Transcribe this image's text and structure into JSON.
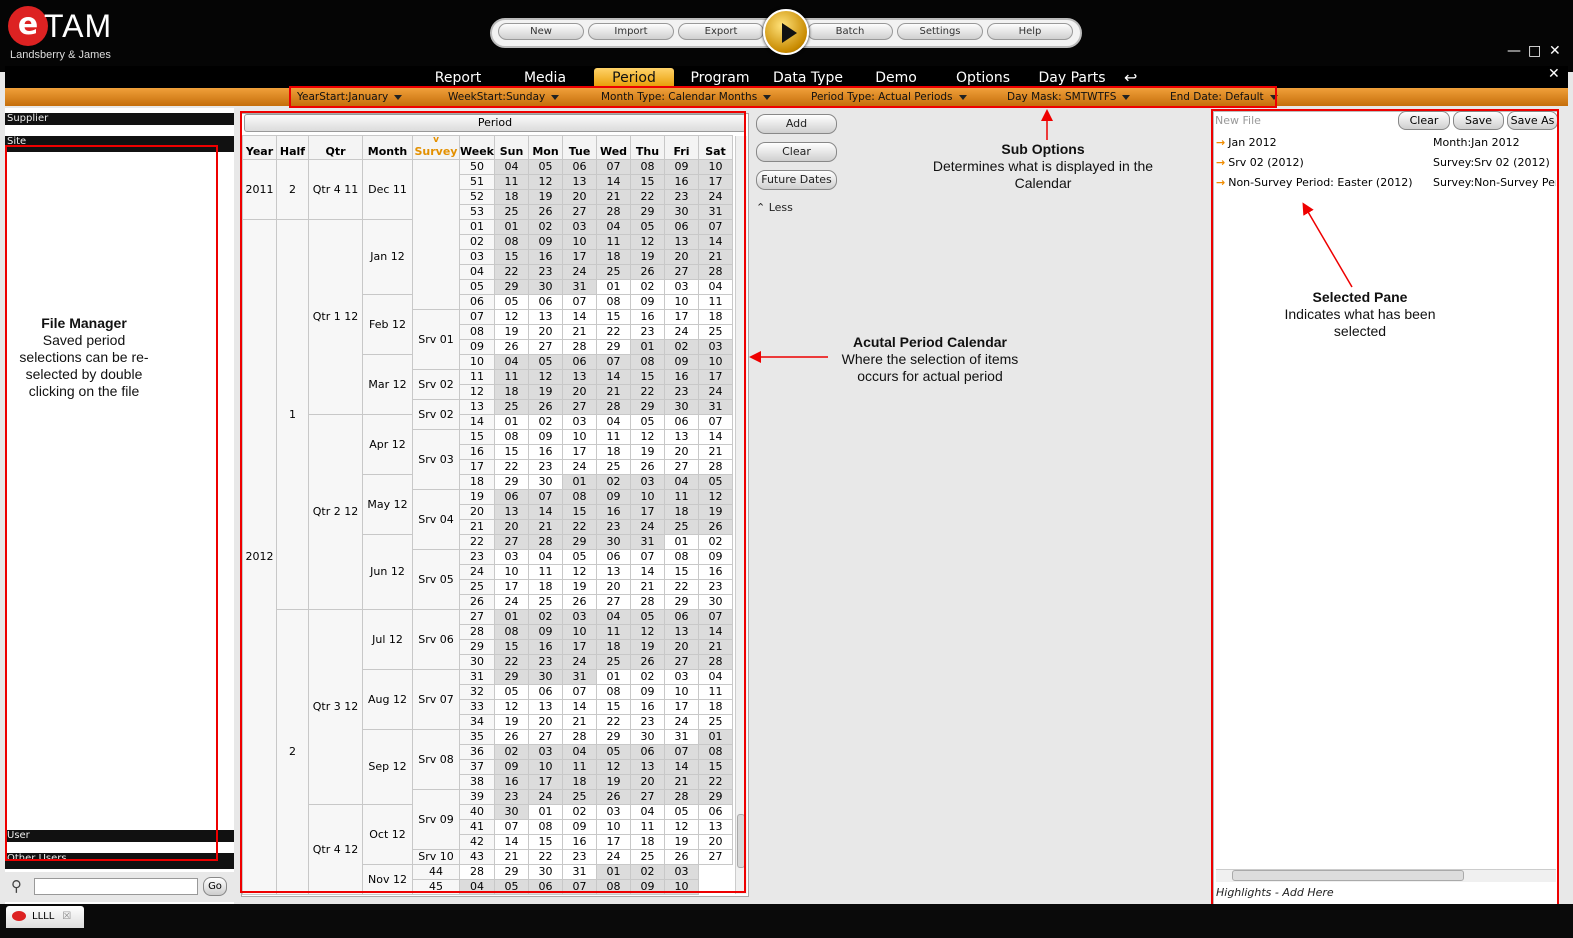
{
  "app": {
    "logo_letter": "e",
    "logo_name": "TAM",
    "logo_sub": "Landsberry & James"
  },
  "toolbar": {
    "buttons": [
      "New",
      "Import",
      "Export",
      "Batch",
      "Settings",
      "Help"
    ]
  },
  "nav": {
    "tabs": [
      "Report",
      "Media",
      "Period",
      "Program",
      "Data Type",
      "Demo",
      "Options",
      "Day Parts"
    ],
    "active": "Period"
  },
  "sub_options": [
    "YearStart:January",
    "WeekStart:Sunday",
    "Month Type: Calendar Months",
    "Period Type: Actual Periods",
    "Day Mask: SMTWTFS",
    "End Date: Default"
  ],
  "left": {
    "supplier": "Supplier",
    "site": "Site",
    "user": "User",
    "other_users": "Other Users",
    "go_label": "Go"
  },
  "calendar": {
    "title": "Period",
    "headers": [
      "Year",
      "Half",
      "Qtr",
      "Month",
      "Survey",
      "Week",
      "Sun",
      "Mon",
      "Tue",
      "Wed",
      "Thu",
      "Fri",
      "Sat"
    ],
    "survey_marker": "v",
    "rows": [
      {
        "wk": "50",
        "d": [
          "04",
          "05",
          "06",
          "07",
          "08",
          "09",
          "10"
        ],
        "g": "1111111"
      },
      {
        "wk": "51",
        "d": [
          "11",
          "12",
          "13",
          "14",
          "15",
          "16",
          "17"
        ],
        "g": "1111111"
      },
      {
        "wk": "52",
        "d": [
          "18",
          "19",
          "20",
          "21",
          "22",
          "23",
          "24"
        ],
        "g": "1111111"
      },
      {
        "wk": "53",
        "d": [
          "25",
          "26",
          "27",
          "28",
          "29",
          "30",
          "31"
        ],
        "g": "1111111"
      },
      {
        "wk": "01",
        "d": [
          "01",
          "02",
          "03",
          "04",
          "05",
          "06",
          "07"
        ],
        "g": "1111111"
      },
      {
        "wk": "02",
        "d": [
          "08",
          "09",
          "10",
          "11",
          "12",
          "13",
          "14"
        ],
        "g": "1111111"
      },
      {
        "wk": "03",
        "d": [
          "15",
          "16",
          "17",
          "18",
          "19",
          "20",
          "21"
        ],
        "g": "1111111"
      },
      {
        "wk": "04",
        "d": [
          "22",
          "23",
          "24",
          "25",
          "26",
          "27",
          "28"
        ],
        "g": "1111111"
      },
      {
        "wk": "05",
        "d": [
          "29",
          "30",
          "31",
          "01",
          "02",
          "03",
          "04"
        ],
        "g": "1110000"
      },
      {
        "wk": "06",
        "d": [
          "05",
          "06",
          "07",
          "08",
          "09",
          "10",
          "11"
        ],
        "g": "0000000"
      },
      {
        "wk": "07",
        "d": [
          "12",
          "13",
          "14",
          "15",
          "16",
          "17",
          "18"
        ],
        "g": "0000000"
      },
      {
        "wk": "08",
        "d": [
          "19",
          "20",
          "21",
          "22",
          "23",
          "24",
          "25"
        ],
        "g": "0000000"
      },
      {
        "wk": "09",
        "d": [
          "26",
          "27",
          "28",
          "29",
          "01",
          "02",
          "03"
        ],
        "g": "0000111"
      },
      {
        "wk": "10",
        "d": [
          "04",
          "05",
          "06",
          "07",
          "08",
          "09",
          "10"
        ],
        "g": "1111111"
      },
      {
        "wk": "11",
        "d": [
          "11",
          "12",
          "13",
          "14",
          "15",
          "16",
          "17"
        ],
        "g": "1111111"
      },
      {
        "wk": "12",
        "d": [
          "18",
          "19",
          "20",
          "21",
          "22",
          "23",
          "24"
        ],
        "g": "1111111"
      },
      {
        "wk": "13",
        "d": [
          "25",
          "26",
          "27",
          "28",
          "29",
          "30",
          "31"
        ],
        "g": "1111111"
      },
      {
        "wk": "14",
        "d": [
          "01",
          "02",
          "03",
          "04",
          "05",
          "06",
          "07"
        ],
        "g": "0000000"
      },
      {
        "wk": "15",
        "d": [
          "08",
          "09",
          "10",
          "11",
          "12",
          "13",
          "14"
        ],
        "g": "0000000"
      },
      {
        "wk": "16",
        "d": [
          "15",
          "16",
          "17",
          "18",
          "19",
          "20",
          "21"
        ],
        "g": "0000000"
      },
      {
        "wk": "17",
        "d": [
          "22",
          "23",
          "24",
          "25",
          "26",
          "27",
          "28"
        ],
        "g": "0000000"
      },
      {
        "wk": "18",
        "d": [
          "29",
          "30",
          "01",
          "02",
          "03",
          "04",
          "05"
        ],
        "g": "0011111"
      },
      {
        "wk": "19",
        "d": [
          "06",
          "07",
          "08",
          "09",
          "10",
          "11",
          "12"
        ],
        "g": "1111111"
      },
      {
        "wk": "20",
        "d": [
          "13",
          "14",
          "15",
          "16",
          "17",
          "18",
          "19"
        ],
        "g": "1111111"
      },
      {
        "wk": "21",
        "d": [
          "20",
          "21",
          "22",
          "23",
          "24",
          "25",
          "26"
        ],
        "g": "1111111"
      },
      {
        "wk": "22",
        "d": [
          "27",
          "28",
          "29",
          "30",
          "31",
          "01",
          "02"
        ],
        "g": "1111100"
      },
      {
        "wk": "23",
        "d": [
          "03",
          "04",
          "05",
          "06",
          "07",
          "08",
          "09"
        ],
        "g": "0000000"
      },
      {
        "wk": "24",
        "d": [
          "10",
          "11",
          "12",
          "13",
          "14",
          "15",
          "16"
        ],
        "g": "0000000"
      },
      {
        "wk": "25",
        "d": [
          "17",
          "18",
          "19",
          "20",
          "21",
          "22",
          "23"
        ],
        "g": "0000000"
      },
      {
        "wk": "26",
        "d": [
          "24",
          "25",
          "26",
          "27",
          "28",
          "29",
          "30"
        ],
        "g": "0000000"
      },
      {
        "wk": "27",
        "d": [
          "01",
          "02",
          "03",
          "04",
          "05",
          "06",
          "07"
        ],
        "g": "1111111"
      },
      {
        "wk": "28",
        "d": [
          "08",
          "09",
          "10",
          "11",
          "12",
          "13",
          "14"
        ],
        "g": "1111111"
      },
      {
        "wk": "29",
        "d": [
          "15",
          "16",
          "17",
          "18",
          "19",
          "20",
          "21"
        ],
        "g": "1111111"
      },
      {
        "wk": "30",
        "d": [
          "22",
          "23",
          "24",
          "25",
          "26",
          "27",
          "28"
        ],
        "g": "1111111"
      },
      {
        "wk": "31",
        "d": [
          "29",
          "30",
          "31",
          "01",
          "02",
          "03",
          "04"
        ],
        "g": "1110000"
      },
      {
        "wk": "32",
        "d": [
          "05",
          "06",
          "07",
          "08",
          "09",
          "10",
          "11"
        ],
        "g": "0000000"
      },
      {
        "wk": "33",
        "d": [
          "12",
          "13",
          "14",
          "15",
          "16",
          "17",
          "18"
        ],
        "g": "0000000"
      },
      {
        "wk": "34",
        "d": [
          "19",
          "20",
          "21",
          "22",
          "23",
          "24",
          "25"
        ],
        "g": "0000000"
      },
      {
        "wk": "35",
        "d": [
          "26",
          "27",
          "28",
          "29",
          "30",
          "31",
          "01"
        ],
        "g": "0000001"
      },
      {
        "wk": "36",
        "d": [
          "02",
          "03",
          "04",
          "05",
          "06",
          "07",
          "08"
        ],
        "g": "1111111"
      },
      {
        "wk": "37",
        "d": [
          "09",
          "10",
          "11",
          "12",
          "13",
          "14",
          "15"
        ],
        "g": "1111111"
      },
      {
        "wk": "38",
        "d": [
          "16",
          "17",
          "18",
          "19",
          "20",
          "21",
          "22"
        ],
        "g": "1111111"
      },
      {
        "wk": "39",
        "d": [
          "23",
          "24",
          "25",
          "26",
          "27",
          "28",
          "29"
        ],
        "g": "1111111"
      },
      {
        "wk": "40",
        "d": [
          "30",
          "01",
          "02",
          "03",
          "04",
          "05",
          "06"
        ],
        "g": "1000000"
      },
      {
        "wk": "41",
        "d": [
          "07",
          "08",
          "09",
          "10",
          "11",
          "12",
          "13"
        ],
        "g": "0000000"
      },
      {
        "wk": "42",
        "d": [
          "14",
          "15",
          "16",
          "17",
          "18",
          "19",
          "20"
        ],
        "g": "0000000"
      },
      {
        "wk": "43",
        "d": [
          "21",
          "22",
          "23",
          "24",
          "25",
          "26",
          "27"
        ],
        "g": "0000000"
      },
      {
        "wk": "44",
        "d": [
          "28",
          "29",
          "30",
          "31",
          "01",
          "02",
          "03"
        ],
        "g": "0000111"
      },
      {
        "wk": "45",
        "d": [
          "04",
          "05",
          "06",
          "07",
          "08",
          "09",
          "10"
        ],
        "g": "1111111"
      }
    ],
    "years": [
      {
        "label": "2011",
        "span": 4
      },
      {
        "label": "2012",
        "span": 45
      }
    ],
    "halves": [
      {
        "label": "2",
        "span": 4
      },
      {
        "label": "1",
        "span": 26
      },
      {
        "label": "2",
        "span": 19
      }
    ],
    "qtrs": [
      {
        "label": "Qtr 4 11",
        "span": 4
      },
      {
        "label": "Qtr 1 12",
        "span": 13
      },
      {
        "label": "Qtr 2 12",
        "span": 13
      },
      {
        "label": "Qtr 3 12",
        "span": 13
      },
      {
        "label": "Qtr 4 12",
        "span": 6
      }
    ],
    "months": [
      {
        "label": "Dec 11",
        "span": 4
      },
      {
        "label": "Jan 12",
        "span": 5
      },
      {
        "label": "Feb 12",
        "span": 4
      },
      {
        "label": "Mar 12",
        "span": 4
      },
      {
        "label": "Apr 12",
        "span": 4
      },
      {
        "label": "May 12",
        "span": 4
      },
      {
        "label": "Jun 12",
        "span": 5
      },
      {
        "label": "Jul 12",
        "span": 4
      },
      {
        "label": "Aug 12",
        "span": 4
      },
      {
        "label": "Sep 12",
        "span": 5
      },
      {
        "label": "Oct 12",
        "span": 4
      },
      {
        "label": "Nov 12",
        "span": 2
      }
    ],
    "surveys": [
      {
        "label": "",
        "span": 10
      },
      {
        "label": "Srv 01",
        "span": 4
      },
      {
        "label": "Srv 02",
        "span": 2
      },
      {
        "label": "Srv 02",
        "span": 2
      },
      {
        "label": "Srv 03",
        "span": 4
      },
      {
        "label": "Srv 04",
        "span": 4
      },
      {
        "label": "Srv 05",
        "span": 4
      },
      {
        "label": "Srv 06",
        "span": 4
      },
      {
        "label": "Srv 07",
        "span": 4
      },
      {
        "label": "Srv 08",
        "span": 4
      },
      {
        "label": "Srv 09",
        "span": 4
      },
      {
        "label": "Srv 10",
        "span": 1
      }
    ]
  },
  "side_buttons": {
    "add": "Add",
    "clear": "Clear",
    "future": "Future Dates",
    "less": "Less"
  },
  "right": {
    "placeholder": "New File",
    "clear": "Clear",
    "save": "Save",
    "save_as": "Save As",
    "items": [
      {
        "name": "Jan 2012",
        "value": "Month:Jan 2012"
      },
      {
        "name": "Srv 02 (2012)",
        "value": "Survey:Srv 02 (2012)"
      },
      {
        "name": "Non-Survey Period: Easter  (2012)",
        "value": "Survey:Non-Survey Peri"
      }
    ],
    "highlights": "Highlights - Add Here"
  },
  "annotations": {
    "file_manager_title": "File Manager",
    "file_manager_text": "Saved period selections can be re-selected by double clicking on the file",
    "calendar_title": "Acutal Period Calendar",
    "calendar_text": "Where the selection of items occurs for actual period",
    "sub_title": "Sub Options",
    "sub_text": "Determines what is displayed in the Calendar",
    "selected_title": "Selected Pane",
    "selected_text": "Indicates what has been selected"
  },
  "footer": {
    "tab": "LLLL"
  }
}
